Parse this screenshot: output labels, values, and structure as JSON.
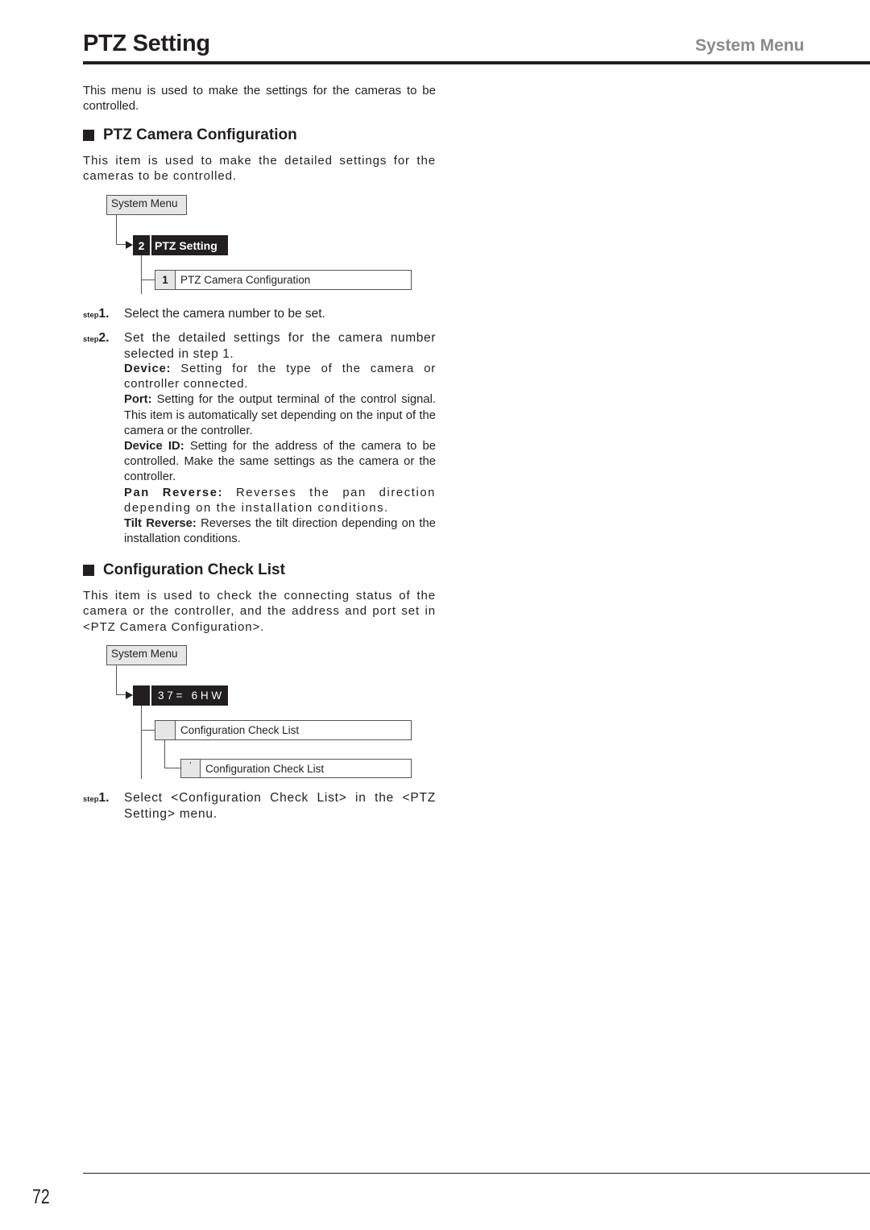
{
  "header": {
    "title": "PTZ Setting",
    "section": "System Menu"
  },
  "intro": "This menu is used to make the settings for the cameras to be controlled.",
  "sections": [
    {
      "heading": "PTZ Camera Configuration",
      "description": "This item is used to make the detailed settings for the cameras to be controlled.",
      "diagram": {
        "root": "System Menu",
        "level1": {
          "number": "2",
          "label": "PTZ Setting"
        },
        "level2": {
          "number": "1",
          "label": "PTZ Camera Configuration"
        }
      },
      "steps": [
        {
          "prefix": "step",
          "number": "1.",
          "text": "Select the camera number to be set."
        },
        {
          "prefix": "step",
          "number": "2.",
          "text": "Set the detailed settings for the camera number selected in step 1.",
          "details": [
            {
              "term": "Device:",
              "text": " Setting for the type of the camera or controller connected."
            },
            {
              "term": "Port:",
              "text": " Setting for the output terminal of the control signal. This item is automatically set depending on the input of the camera or the controller."
            },
            {
              "term": "Device ID:",
              "text": " Setting for the address of the camera to be controlled. Make the same settings as the camera or the controller."
            },
            {
              "term": "Pan Reverse:",
              "text": " Reverses the pan direction depending on the installation conditions."
            },
            {
              "term": "Tilt Reverse:",
              "text": " Reverses the tilt direction depending on the installation conditions."
            }
          ]
        }
      ]
    },
    {
      "heading": "Configuration Check List",
      "description": "This item is used to check the connecting status of the camera or the controller, and the address and port set in <PTZ Camera Configuration>.",
      "diagram": {
        "root": "System Menu",
        "level1": {
          "number": "",
          "label": "3 7 =   6 H W"
        },
        "level2": {
          "number": "",
          "label": "Configuration Check List"
        },
        "level3": {
          "number": "'",
          "label": "Configuration Check List"
        }
      },
      "steps": [
        {
          "prefix": "step",
          "number": "1.",
          "text": "Select <Configuration Check List> in the <PTZ Setting> menu."
        }
      ]
    }
  ],
  "footer": {
    "page_number": "72"
  }
}
